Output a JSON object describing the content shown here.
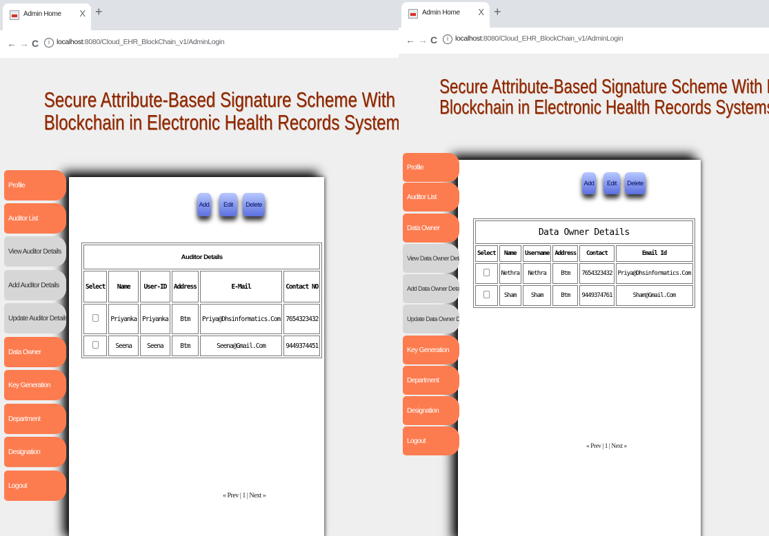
{
  "windows": [
    {
      "tab": {
        "title": "Admin Home",
        "close": "X",
        "newtab": "+"
      },
      "nav": {
        "back": "←",
        "forward": "→",
        "reload": "C",
        "info": "i"
      },
      "url": {
        "host": "localhost",
        "path": ":8080/Cloud_EHR_BlockChain_v1/AdminLogin"
      },
      "site_title": {
        "line1": "Secure Attribute-Based Signature Scheme With Multiple Authorities for",
        "line2": "Blockchain in Electronic Health Records Systems"
      },
      "menu": [
        "Profile",
        "Auditor List",
        "View Auditor Details",
        "Add Auditor Details",
        "Update Auditor Details",
        "Data Owner",
        "Key Generation",
        "Department",
        "Designation",
        "Logout"
      ],
      "buttons": {
        "add": "Add",
        "edit": "Edit",
        "delete": "Delete"
      },
      "table": {
        "caption": "Auditor Details",
        "headers": [
          "Select",
          "Name",
          "User-ID",
          "Address",
          "E-Mail",
          "Contact NO"
        ],
        "rows": [
          [
            "Priyanka",
            "Priyanka",
            "Btm",
            "Priya@Dhsinformatics.Com",
            "7654323432"
          ],
          [
            "Seena",
            "Seena",
            "Btm",
            "Seena@Gmail.Com",
            "9449374451"
          ]
        ]
      },
      "pager": {
        "prev": "« Prev",
        "sep1": "|",
        "page": "1",
        "sep2": "|",
        "next": "Next »"
      }
    },
    {
      "tab": {
        "title": "Admin Home",
        "close": "X",
        "newtab": "+"
      },
      "nav": {
        "back": "←",
        "forward": "→",
        "reload": "C",
        "info": "i"
      },
      "url": {
        "host": "localhost",
        "path": ":8080/Cloud_EHR_BlockChain_v1/AdminLogin"
      },
      "site_title": {
        "line1": "Secure Attribute-Based Signature Scheme With Multiple Authorities for",
        "line2": "Blockchain in Electronic Health Records Systems"
      },
      "menu": [
        "Profile",
        "Auditor List",
        "Data Owner",
        "View Data Owner Details",
        "Add Data Owner Details",
        "Update Data Owner Details",
        "Key Generation",
        "Department",
        "Designation",
        "Logout"
      ],
      "buttons": {
        "add": "Add",
        "edit": "Edit",
        "delete": "Delete"
      },
      "table": {
        "caption": "Data Owner Details",
        "headers": [
          "Select",
          "Name",
          "Username",
          "Address",
          "Contact",
          "Email Id"
        ],
        "rows": [
          [
            "Nethra",
            "Nethra",
            "Btm",
            "7654323432",
            "Priya@Dhsinformatics.Com"
          ],
          [
            "Sham",
            "Sham",
            "Btm",
            "9449374761",
            "Sham@Gmail.Com"
          ]
        ]
      },
      "pager": {
        "prev": "« Prev",
        "sep1": "|",
        "page": "1",
        "sep2": "|",
        "next": "Next »"
      }
    }
  ]
}
